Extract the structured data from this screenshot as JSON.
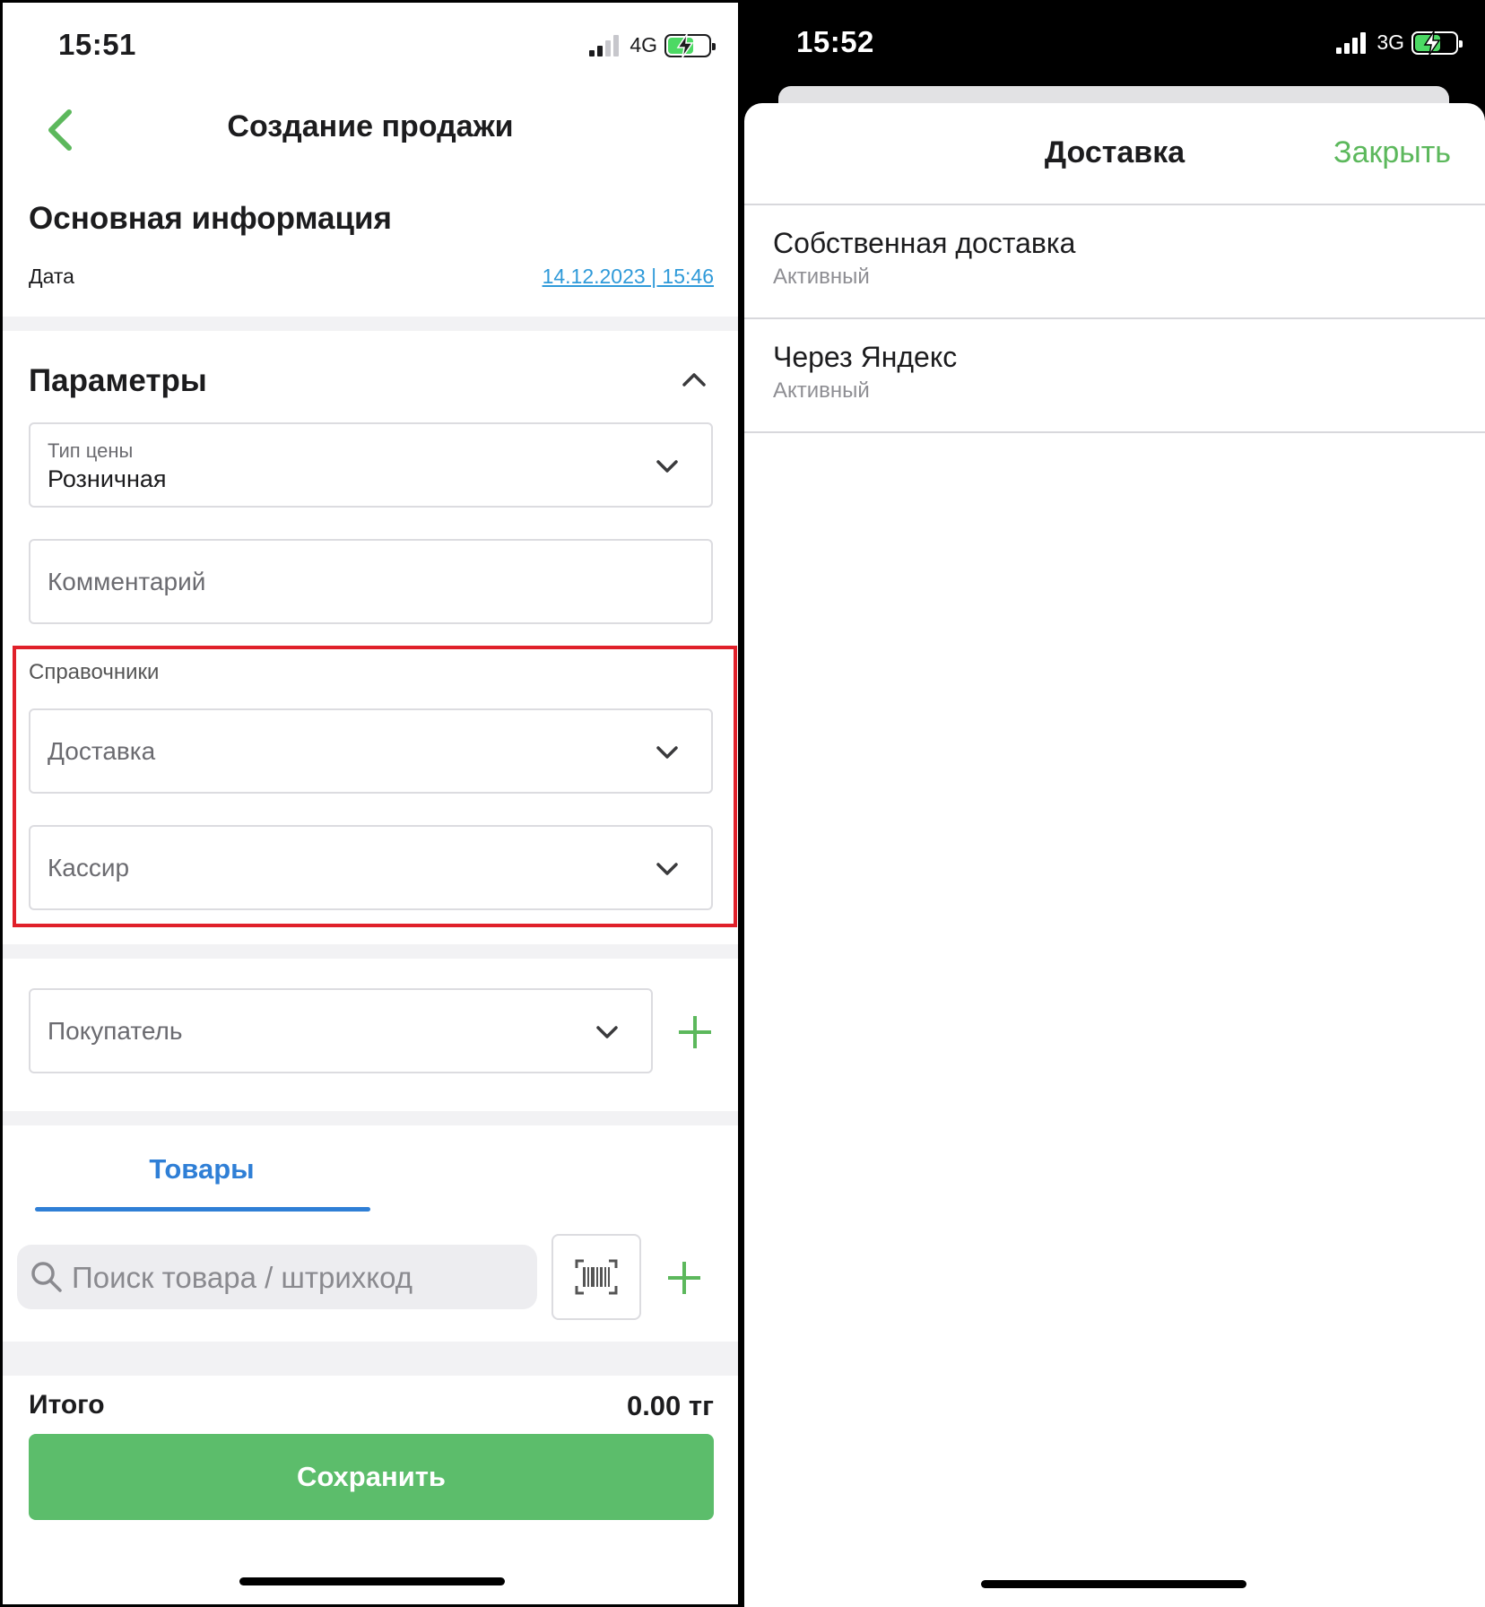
{
  "left": {
    "status": {
      "time": "15:51",
      "network": "4G"
    },
    "header": {
      "title": "Создание продажи"
    },
    "main_info": {
      "title": "Основная информация",
      "date_label": "Дата",
      "date_value": "14.12.2023  |  15:46"
    },
    "params": {
      "title": "Параметры",
      "price_type": {
        "label": "Тип цены",
        "value": "Розничная"
      },
      "comment_placeholder": "Комментарий",
      "references": {
        "label": "Справочники",
        "delivery_placeholder": "Доставка",
        "cashier_placeholder": "Кассир"
      },
      "buyer_placeholder": "Покупатель"
    },
    "tabs": {
      "goods": "Товары"
    },
    "search": {
      "placeholder": "Поиск товара / штрихкод"
    },
    "total": {
      "label": "Итого",
      "value": "0.00 тг"
    },
    "save_button": "Сохранить"
  },
  "right": {
    "status": {
      "time": "15:52",
      "network": "3G"
    },
    "sheet": {
      "title": "Доставка",
      "close": "Закрыть",
      "options": [
        {
          "name": "Собственная доставка",
          "status": "Активный"
        },
        {
          "name": "Через Яндекс",
          "status": "Активный"
        }
      ]
    }
  },
  "colors": {
    "accent_green": "#5cbd6b",
    "link_blue": "#2f9ad9",
    "tab_blue": "#2f7fd6",
    "highlight_red": "#e0202a"
  },
  "icons": [
    "back-chevron-icon",
    "chevron-up-icon",
    "chevron-down-icon",
    "plus-icon",
    "search-icon",
    "barcode-scan-icon",
    "signal-icon",
    "battery-charging-icon"
  ]
}
